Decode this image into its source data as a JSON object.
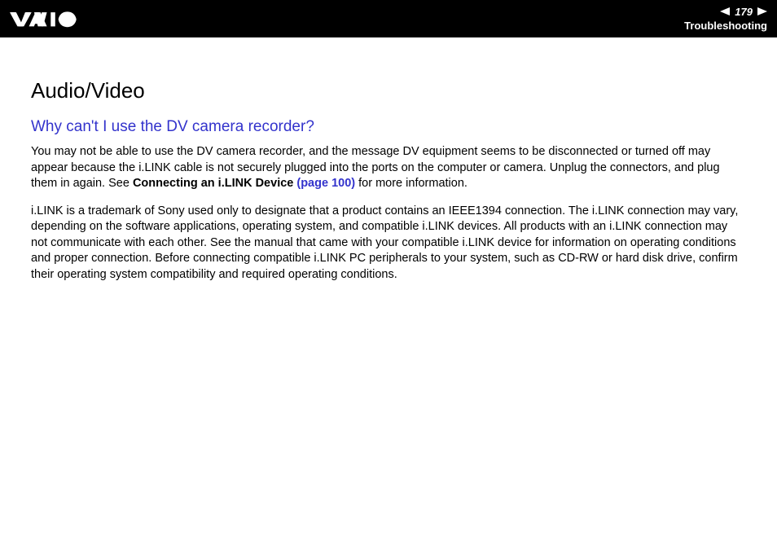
{
  "header": {
    "page_number": "179",
    "section_label": "Troubleshooting"
  },
  "content": {
    "section_title": "Audio/Video",
    "question": "Why can't I use the DV camera recorder?",
    "paragraph1_part1": "You may not be able to use the DV camera recorder, and the message DV equipment seems to be disconnected or turned off may appear because the i.LINK cable is not securely plugged into the ports on the computer or camera. Unplug the connectors, and plug them in again. See ",
    "paragraph1_bold": "Connecting an i.LINK Device ",
    "paragraph1_link": "(page 100)",
    "paragraph1_part2": " for more information.",
    "paragraph2": "i.LINK is a trademark of Sony used only to designate that a product contains an IEEE1394 connection. The i.LINK connection may vary, depending on the software applications, operating system, and compatible i.LINK devices. All products with an i.LINK connection may not communicate with each other. See the manual that came with your compatible i.LINK device for information on operating conditions and proper connection. Before connecting compatible i.LINK PC peripherals to your system, such as CD-RW or hard disk drive, confirm their operating system compatibility and required operating conditions."
  }
}
